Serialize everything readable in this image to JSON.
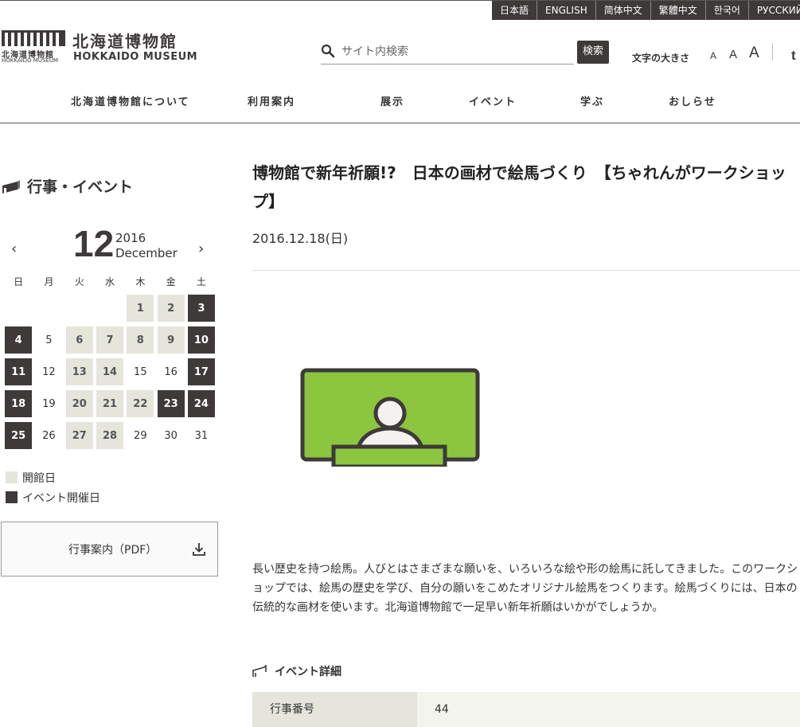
{
  "languages": [
    "日本語",
    "ENGLISH",
    "简体中文",
    "繁體中文",
    "한국어",
    "РУССКИЙ"
  ],
  "logo": {
    "jp_small": "北海道博物館",
    "en_small": "HOKKAIDO MUSEUM",
    "jp": "北海道博物館",
    "en": "HOKKAIDO MUSEUM"
  },
  "search": {
    "placeholder": "サイト内検索",
    "button": "検索"
  },
  "fontsize": {
    "label": "文字の大きさ",
    "small": "A",
    "medium": "A",
    "large": "A"
  },
  "share_icon": "t",
  "nav": [
    "北海道博物館について",
    "利用案内",
    "展示",
    "イベント",
    "学ぶ",
    "おしらせ"
  ],
  "sidebar": {
    "title": "行事・イベント",
    "calendar": {
      "prev": "‹",
      "next": "›",
      "month": "12",
      "year": "2016",
      "month_name": "December",
      "weekdays": [
        "日",
        "月",
        "火",
        "水",
        "木",
        "金",
        "土"
      ],
      "days": [
        {
          "d": "",
          "s": "blank"
        },
        {
          "d": "",
          "s": "blank"
        },
        {
          "d": "",
          "s": "blank"
        },
        {
          "d": "",
          "s": "blank"
        },
        {
          "d": "1",
          "s": "open"
        },
        {
          "d": "2",
          "s": "open"
        },
        {
          "d": "3",
          "s": "event"
        },
        {
          "d": "4",
          "s": "event"
        },
        {
          "d": "5",
          "s": "closed"
        },
        {
          "d": "6",
          "s": "open"
        },
        {
          "d": "7",
          "s": "open"
        },
        {
          "d": "8",
          "s": "open"
        },
        {
          "d": "9",
          "s": "open"
        },
        {
          "d": "10",
          "s": "event"
        },
        {
          "d": "11",
          "s": "event"
        },
        {
          "d": "12",
          "s": "closed"
        },
        {
          "d": "13",
          "s": "open"
        },
        {
          "d": "14",
          "s": "open"
        },
        {
          "d": "15",
          "s": "closed"
        },
        {
          "d": "16",
          "s": "closed"
        },
        {
          "d": "17",
          "s": "event"
        },
        {
          "d": "18",
          "s": "event"
        },
        {
          "d": "19",
          "s": "closed"
        },
        {
          "d": "20",
          "s": "open"
        },
        {
          "d": "21",
          "s": "open"
        },
        {
          "d": "22",
          "s": "open"
        },
        {
          "d": "23",
          "s": "event"
        },
        {
          "d": "24",
          "s": "event"
        },
        {
          "d": "25",
          "s": "event"
        },
        {
          "d": "26",
          "s": "closed"
        },
        {
          "d": "27",
          "s": "open"
        },
        {
          "d": "28",
          "s": "open"
        },
        {
          "d": "29",
          "s": "closed"
        },
        {
          "d": "30",
          "s": "closed"
        },
        {
          "d": "31",
          "s": "closed"
        }
      ]
    },
    "legend": {
      "open": "開館日",
      "event": "イベント開催日"
    },
    "pdf_button": "行事案内（PDF）"
  },
  "main": {
    "title": "博物館で新年祈願!?　日本の画材で絵馬づくり　【ちゃれんがワークショップ】",
    "date": "2016.12.18(日)",
    "description": "長い歴史を持つ絵馬。人びとはさまざまな願いを、いろいろな絵や形の絵馬に託してきました。このワークショップでは、絵馬の歴史を学び、自分の願いをこめたオリジナル絵馬をつくります。絵馬づくりには、日本の伝統的な画材を使います。北海道博物館で一足早い新年祈願はいかがでしょうか。",
    "detail_title": "イベント詳細",
    "detail_rows": [
      {
        "key": "行事番号",
        "value": "44"
      }
    ]
  },
  "colors": {
    "dark": "#3e3a39",
    "open_day": "#e5e5dc",
    "accent_green": "#8cc63f"
  }
}
